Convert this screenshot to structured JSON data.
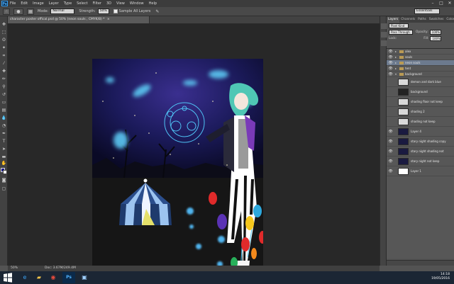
{
  "menubar": {
    "logo": "Ps",
    "items": [
      "File",
      "Edit",
      "Image",
      "Layer",
      "Type",
      "Select",
      "Filter",
      "3D",
      "View",
      "Window",
      "Help"
    ],
    "minimize": "–",
    "maximize": "□",
    "close": "✕"
  },
  "options": {
    "mode_label": "Mode:",
    "mode_value": "Normal",
    "strength_label": "Strength:",
    "strength_value": "50%",
    "sample_all_label": "Sample All Layers",
    "workspace_value": "Essentials"
  },
  "document": {
    "tab_title": "character poster offical.psd @ 50% (neon souls , CMYK/8) *",
    "tab_close": "×",
    "zoom": "50%",
    "doc_info": "Doc: 3.67M/249.4M"
  },
  "panel": {
    "tabs": [
      "Layers",
      "Channels",
      "Paths",
      "Swatches",
      "Color"
    ],
    "kind_value": "Pixel Kind",
    "blend_value": "Pass Through",
    "opacity_label": "Opacity:",
    "opacity_value": "100%",
    "lock_label": "Lock:",
    "fill_label": "Fill:",
    "fill_value": "100%"
  },
  "layers": [
    {
      "name": "alex",
      "kind": "group",
      "visible": true,
      "selected": false
    },
    {
      "name": "souls",
      "kind": "group",
      "visible": true,
      "selected": false
    },
    {
      "name": "neon souls",
      "kind": "group",
      "visible": true,
      "selected": true
    },
    {
      "name": "tent",
      "kind": "group",
      "visible": true,
      "selected": false
    },
    {
      "name": "background",
      "kind": "group-open",
      "visible": true,
      "selected": false
    },
    {
      "name": "demon and dark blue",
      "kind": "layer",
      "visible": false,
      "selected": false,
      "thumb": "#d9d9d9"
    },
    {
      "name": "background",
      "kind": "layer",
      "visible": false,
      "selected": false,
      "thumb": "#222222"
    },
    {
      "name": "shading floor not keep",
      "kind": "layer",
      "visible": false,
      "selected": false,
      "thumb": "#d9d9d9"
    },
    {
      "name": "shading 2",
      "kind": "layer",
      "visible": false,
      "selected": false,
      "thumb": "#d9d9d9"
    },
    {
      "name": "shading not keep",
      "kind": "layer",
      "visible": false,
      "selected": false,
      "thumb": "#d9d9d9"
    },
    {
      "name": "Layer 4",
      "kind": "layer",
      "visible": true,
      "selected": false,
      "thumb": "#1a1a40"
    },
    {
      "name": "stary night shading copy",
      "kind": "layer",
      "visible": true,
      "selected": false,
      "thumb": "#1a1a40"
    },
    {
      "name": "stary night shading not",
      "kind": "layer",
      "visible": true,
      "selected": false,
      "thumb": "#1a1a40"
    },
    {
      "name": "stary night  not keep",
      "kind": "layer",
      "visible": true,
      "selected": false,
      "thumb": "#1a1a40"
    },
    {
      "name": "Layer 1",
      "kind": "layer",
      "visible": true,
      "selected": false,
      "thumb": "#ffffff"
    }
  ],
  "tray": {
    "time": "14:18",
    "date": "19/05/2016"
  },
  "icons": {
    "eye": "eye-icon",
    "folder": "folder-icon",
    "start": "windows-start-icon"
  },
  "colors": {
    "foreground": "#1c1c8a",
    "background": "#ffffff",
    "selection": "#6c7a8e"
  }
}
